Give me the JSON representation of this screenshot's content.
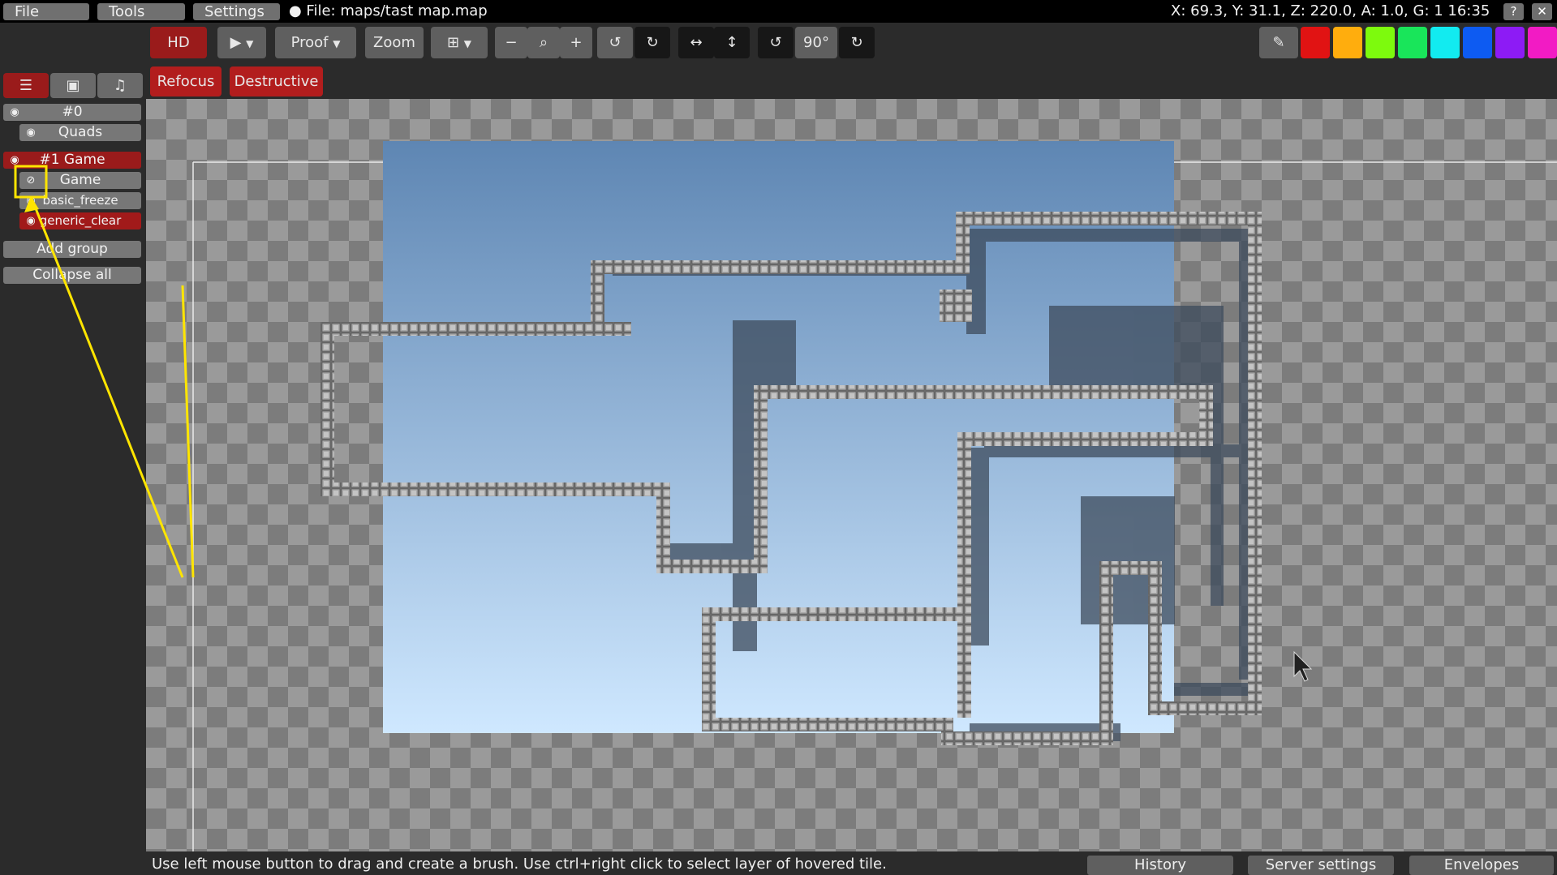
{
  "menubar": {
    "file": "File",
    "tools": "Tools",
    "settings": "Settings",
    "file_title": "● File: maps/tast map.map",
    "status": "X: 69.3, Y: 31.1, Z: 220.0, A: 1.0, G: 1  16:35",
    "help_icon": "?",
    "close_icon": "✕"
  },
  "toolbar": {
    "hd": "HD",
    "proof": "Proof",
    "zoom": "Zoom",
    "rotation": "90°",
    "refocus": "Refocus",
    "destructive": "Destructive",
    "icons": [
      "play-icon",
      "grid-icon",
      "zoom-out-icon",
      "zoom-reset-icon",
      "zoom-in-icon",
      "undo-icon",
      "redo-icon",
      "flip-horizontal-icon",
      "flip-vertical-icon",
      "rotate-ccw-icon",
      "rotate-cw-icon",
      "eyedropper-icon"
    ]
  },
  "palette": [
    "#e11313",
    "#ffad0d",
    "#7dfa0d",
    "#19e55a",
    "#12ebf0",
    "#0d5bf2",
    "#8d1bf5",
    "#f21bc4"
  ],
  "sidebar": {
    "tabs": [
      "layers-icon",
      "images-icon",
      "sounds-icon"
    ],
    "group0": "#0",
    "quads": "Quads",
    "group1": "#1 Game",
    "game": "Game",
    "basic_freeze": "basic_freeze",
    "generic_clear": "generic_clear",
    "add_group": "Add group",
    "collapse_all": "Collapse all"
  },
  "statusbar": {
    "hint": "Use left mouse button to drag and create a brush. Use ctrl+right click to select layer of hovered tile.",
    "history": "History",
    "server_settings": "Server settings",
    "envelopes": "Envelopes"
  },
  "colors": {
    "accent_red": "#9a1b1b",
    "annotation_yellow": "#ffe500",
    "sky_top": "#5e86b3",
    "sky_bottom": "#cfe8ff"
  }
}
